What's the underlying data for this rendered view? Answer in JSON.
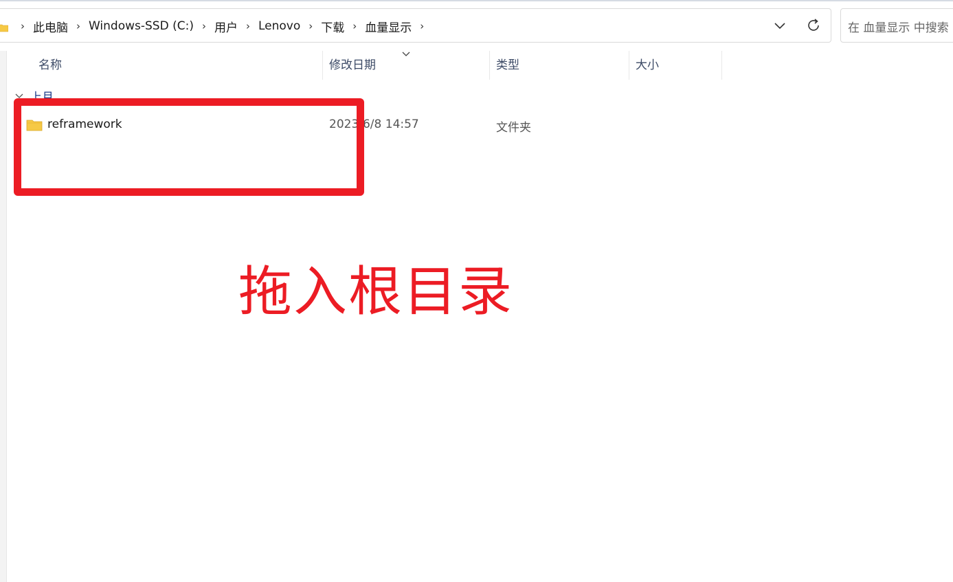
{
  "address_bar": {
    "breadcrumbs": [
      "此电脑",
      "Windows-SSD (C:)",
      "用户",
      "Lenovo",
      "下载",
      "血量显示"
    ],
    "separator": "›"
  },
  "search": {
    "placeholder": "在 血量显示 中搜索"
  },
  "columns": {
    "name": "名称",
    "date": "修改日期",
    "type": "类型",
    "size": "大小"
  },
  "group": {
    "label": "上月"
  },
  "files": [
    {
      "name": "reframework",
      "date": "2023/6/8 14:57",
      "type": "文件夹",
      "size": ""
    }
  ],
  "annotation": {
    "text": "拖入根目录",
    "color": "#ec1c24"
  },
  "colors": {
    "accent_red": "#ec1c24",
    "folder_yellow": "#f6c945",
    "header_text": "#3c4a66",
    "group_text": "#1d3b8a"
  },
  "icons": {
    "address_folder": "folder-icon",
    "dropdown": "chevron-down-icon",
    "refresh": "refresh-icon",
    "row_folder": "folder-icon"
  }
}
